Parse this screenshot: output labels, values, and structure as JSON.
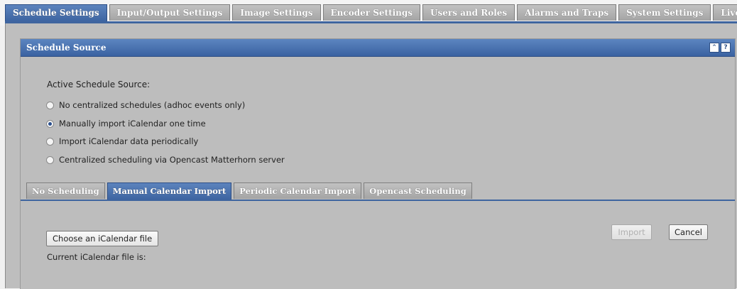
{
  "top_tabs": [
    {
      "label": "Schedule Settings",
      "active": true
    },
    {
      "label": "Input/Output Settings",
      "active": false
    },
    {
      "label": "Image Settings",
      "active": false
    },
    {
      "label": "Encoder Settings",
      "active": false
    },
    {
      "label": "Users and Roles",
      "active": false
    },
    {
      "label": "Alarms and Traps",
      "active": false
    },
    {
      "label": "System Settings",
      "active": false
    },
    {
      "label": "Live View Settings",
      "active": false
    }
  ],
  "section": {
    "title": "Schedule Source",
    "collapse_icon": "double-chevron-up-icon",
    "help_icon": "question-mark-icon"
  },
  "schedule_source": {
    "label": "Active Schedule Source:",
    "options": [
      {
        "label": "No centralized schedules (adhoc events only)",
        "selected": false
      },
      {
        "label": "Manually import iCalendar one time",
        "selected": true
      },
      {
        "label": "Import iCalendar data periodically",
        "selected": false
      },
      {
        "label": "Centralized scheduling via Opencast Matterhorn server",
        "selected": false
      }
    ]
  },
  "sub_tabs": [
    {
      "label": "No Scheduling",
      "active": false
    },
    {
      "label": "Manual Calendar Import",
      "active": true
    },
    {
      "label": "Periodic Calendar Import",
      "active": false
    },
    {
      "label": "Opencast Scheduling",
      "active": false
    }
  ],
  "manual_import": {
    "choose_file_label": "Choose an iCalendar file",
    "current_file_label": "Current iCalendar file is:",
    "import_label": "Import",
    "cancel_label": "Cancel"
  },
  "colors": {
    "accent": "#3f659f",
    "tab_inactive": "#b3b3b3",
    "panel_bg": "#bdbdbd"
  }
}
